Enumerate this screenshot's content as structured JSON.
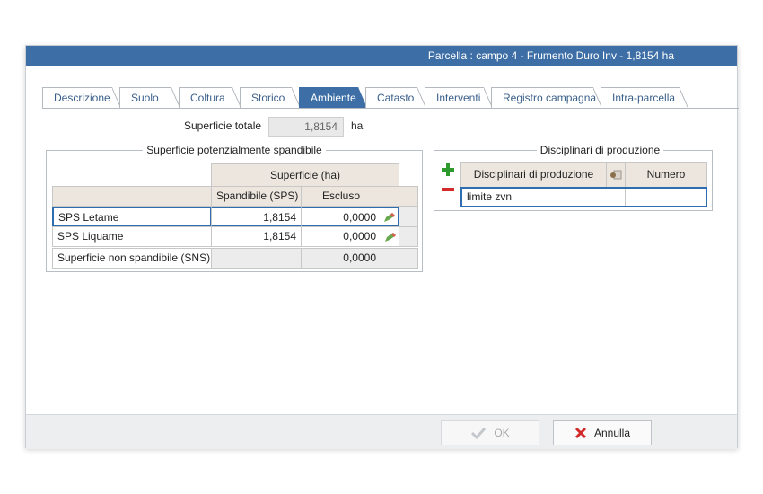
{
  "window": {
    "title": "Parcella : campo 4  - Frumento Duro Inv - 1,8154 ha"
  },
  "tabs": [
    {
      "label": "Descrizione",
      "active": false
    },
    {
      "label": "Suolo",
      "active": false
    },
    {
      "label": "Coltura",
      "active": false
    },
    {
      "label": "Storico",
      "active": false
    },
    {
      "label": "Ambiente",
      "active": true
    },
    {
      "label": "Catasto",
      "active": false
    },
    {
      "label": "Interventi",
      "active": false
    },
    {
      "label": "Registro campagna",
      "active": false
    },
    {
      "label": "Intra-parcella",
      "active": false
    }
  ],
  "surface": {
    "label": "Superficie totale",
    "value": "1,8154",
    "unit": "ha"
  },
  "sps_group": {
    "title": "Superficie potenzialmente spandibile",
    "header_group": "Superficie (ha)",
    "col_sps": "Spandibile (SPS)",
    "col_excluded": "Escluso",
    "rows": [
      {
        "label": "SPS Letame",
        "sps": "1,8154",
        "excluded": "0,0000"
      },
      {
        "label": "SPS Liquame",
        "sps": "1,8154",
        "excluded": "0,0000"
      },
      {
        "label": "Superficie non spandibile (SNS)",
        "sps": "",
        "excluded": "0,0000"
      }
    ]
  },
  "disc_group": {
    "title": "Disciplinari di produzione",
    "col_name": "Disciplinari di produzione",
    "col_number": "Numero",
    "row_value": "limite zvn",
    "row_number": ""
  },
  "buttons": {
    "ok": "OK",
    "cancel": "Annulla"
  },
  "colors": {
    "accent": "#3d6fa6",
    "add": "#2e9a2e",
    "remove": "#d22a2a",
    "cancel_x": "#d22a2a"
  }
}
